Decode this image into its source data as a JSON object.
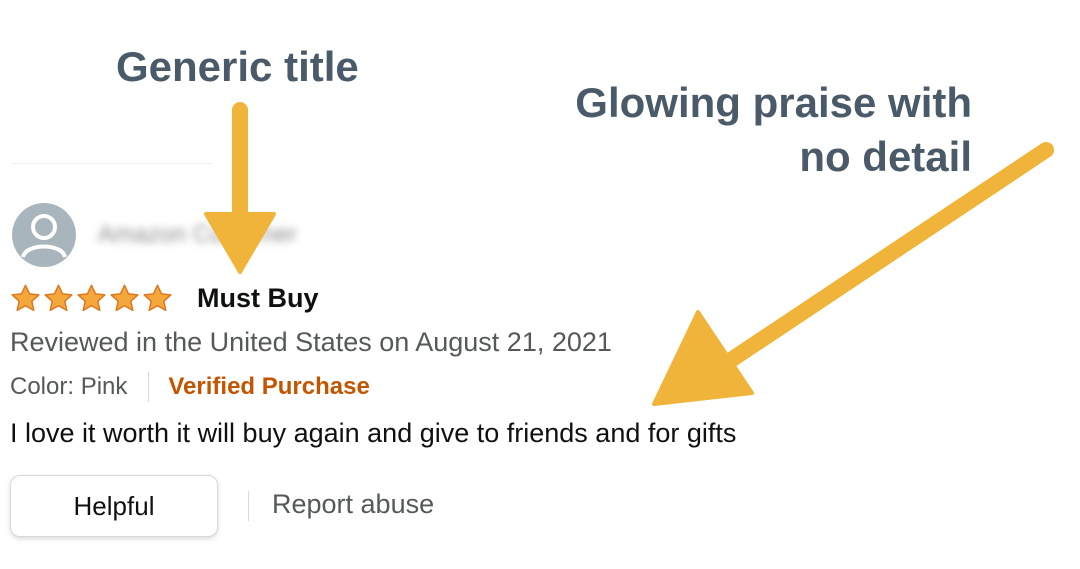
{
  "annotations": {
    "title_callout": "Generic title",
    "praise_callout_line1": "Glowing praise with",
    "praise_callout_line2": "no detail"
  },
  "review": {
    "reviewer_name": "Amazon Customer",
    "rating": 5,
    "rating_max": 5,
    "title": "Must Buy",
    "date_line": "Reviewed in the United States on August 21, 2021",
    "color_label": "Color: Pink",
    "verified_label": "Verified Purchase",
    "body": "I love it worth it will buy again and give to friends and for gifts"
  },
  "actions": {
    "helpful_label": "Helpful",
    "report_label": "Report abuse"
  },
  "colors": {
    "annotation_text": "#4a5a68",
    "arrow": "#f0b43a",
    "star": "#f4a73b",
    "verified": "#c45500",
    "avatar": "#a9b5bd"
  },
  "icons": {
    "avatar": "user-silhouette-icon",
    "star": "star-icon",
    "arrow": "callout-arrow"
  }
}
